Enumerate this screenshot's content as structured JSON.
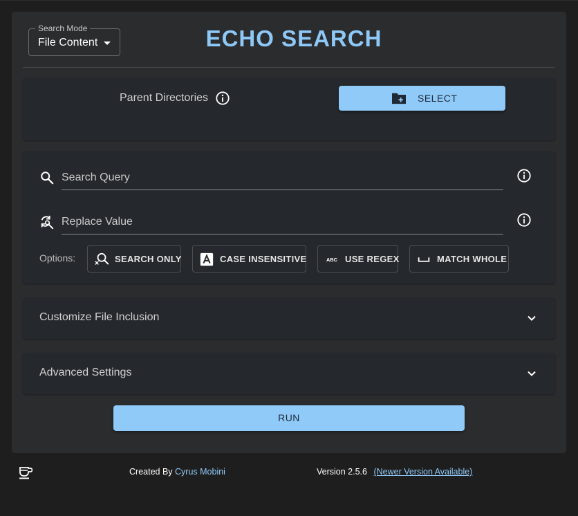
{
  "header": {
    "search_mode_label": "Search Mode",
    "search_mode_value": "File Content",
    "title": "ECHO SEARCH"
  },
  "directories": {
    "label": "Parent Directories",
    "select_button": "SELECT"
  },
  "search": {
    "query_placeholder": "Search Query",
    "replace_placeholder": "Replace Value",
    "options_label": "Options:",
    "options": {
      "search_only": "SEARCH ONLY",
      "case_insensitive": "CASE INSENSITIVE",
      "use_regex": "USE REGEX",
      "match_whole": "MATCH WHOLE"
    }
  },
  "sections": {
    "file_inclusion": "Customize File Inclusion",
    "advanced": "Advanced Settings"
  },
  "run_button": "RUN",
  "footer": {
    "created_by": "Created By",
    "author": "Cyrus Mobini",
    "version": "Version 2.5.6",
    "newer_version": "(Newer Version Available)"
  },
  "icons": {
    "search_mode_caret": "caret-down-icon",
    "info": "info-icon",
    "folder": "folder-plus-icon",
    "search": "search-icon",
    "replace": "find-replace-icon",
    "search_only": "search-off-icon",
    "case": "letter-a-icon",
    "regex": "abc-icon",
    "whole": "space-bar-icon",
    "expand": "chevron-down-icon",
    "footer": "coffee-cup-icon"
  },
  "colors": {
    "accent": "#90caf9",
    "title": "#8ec8f6",
    "panel": "#2b2c2e",
    "card": "#25282c",
    "background": "#1e1e1e"
  }
}
